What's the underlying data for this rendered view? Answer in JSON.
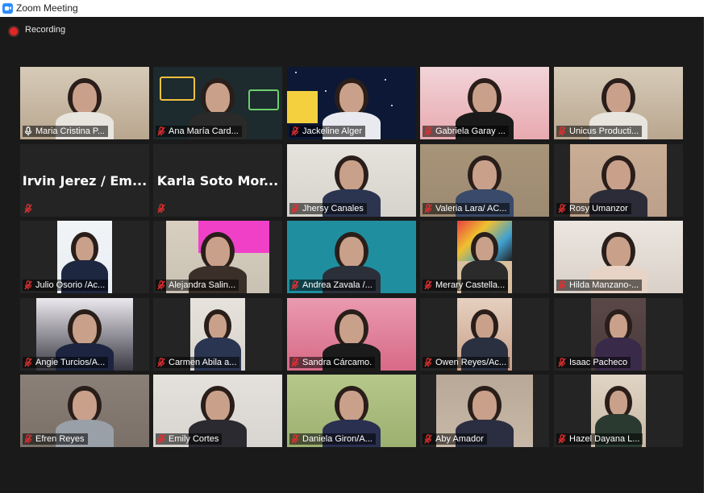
{
  "window": {
    "title": "Zoom Meeting"
  },
  "recording": {
    "label": "Recording"
  },
  "participants": [
    {
      "name": "Maria Cristina P...",
      "mic": "unmuted",
      "active": true,
      "video": true
    },
    {
      "name": "Ana María Card...",
      "mic": "muted",
      "video": true
    },
    {
      "name": "Jackeline Alger",
      "mic": "muted",
      "video": true
    },
    {
      "name": "Gabriela Garay ...",
      "mic": "muted",
      "video": true
    },
    {
      "name": "Unicus Producti...",
      "mic": "muted",
      "video": true
    },
    {
      "name": "",
      "display": "Irvin Jerez / Em...",
      "mic": "muted",
      "video": false
    },
    {
      "name": "",
      "display": "Karla Soto Mor...",
      "mic": "muted",
      "video": false
    },
    {
      "name": "Jhersy Canales",
      "mic": "muted",
      "video": true
    },
    {
      "name": "Valeria Lara/ AC...",
      "mic": "muted",
      "video": true
    },
    {
      "name": "Rosy Umanzor",
      "mic": "muted",
      "video": true
    },
    {
      "name": "Julio Osorio /Ac...",
      "mic": "muted",
      "video": true
    },
    {
      "name": "Alejandra Salin...",
      "mic": "muted",
      "video": true
    },
    {
      "name": "Andrea Zavala /...",
      "mic": "muted",
      "video": true
    },
    {
      "name": "Merary Castella...",
      "mic": "muted",
      "video": true
    },
    {
      "name": "Hilda Manzano-...",
      "mic": "muted",
      "video": true
    },
    {
      "name": "Angie Turcios/A...",
      "mic": "muted",
      "video": true
    },
    {
      "name": "Carmen Abila a...",
      "mic": "muted",
      "video": true
    },
    {
      "name": "Sandra Cárcamo.",
      "mic": "muted",
      "video": true
    },
    {
      "name": "Owen Reyes/Ac...",
      "mic": "muted",
      "video": true
    },
    {
      "name": "Isaac Pacheco",
      "mic": "muted",
      "video": true
    },
    {
      "name": "Efren Reyes",
      "mic": "muted",
      "video": true
    },
    {
      "name": "Emily Cortes",
      "mic": "muted",
      "video": true
    },
    {
      "name": "Daniela Giron/A...",
      "mic": "muted",
      "video": true
    },
    {
      "name": "Aby Amador",
      "mic": "muted",
      "video": true
    },
    {
      "name": "Hazel Dayana L...",
      "mic": "muted",
      "video": true
    }
  ],
  "colors": {
    "active_border": "#c8e05a",
    "muted_mic": "#e03030",
    "stage_bg": "#1a1a1a",
    "tile_bg": "#242424",
    "rec": "#e02828"
  },
  "icons": {
    "app": "zoom-camera-icon",
    "recording": "recording-dot-icon",
    "muted": "mic-muted-icon",
    "unmuted": "mic-icon"
  }
}
